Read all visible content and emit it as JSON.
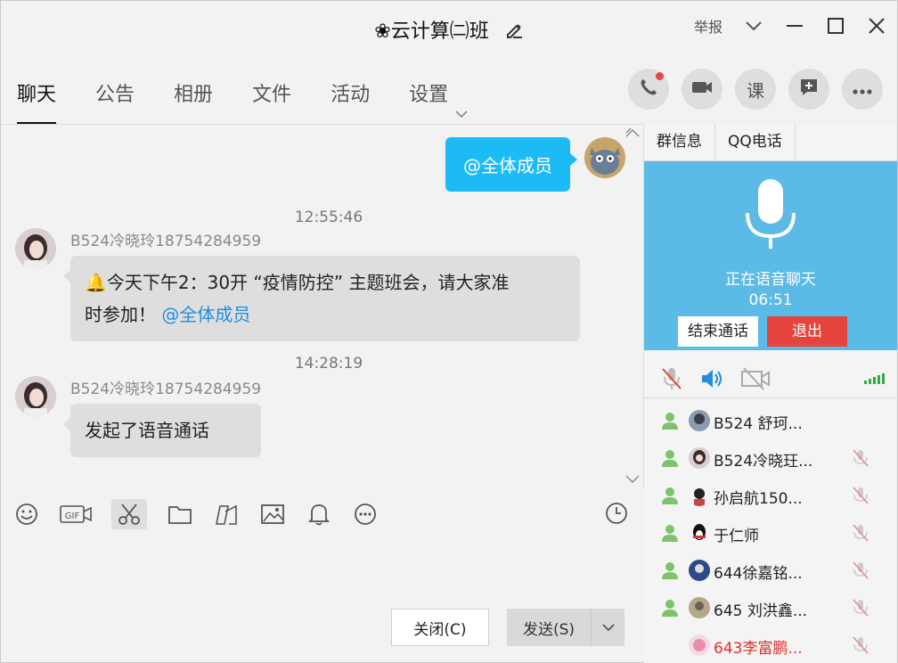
{
  "window": {
    "title": "❀云计算㈡班",
    "report_label": "举报"
  },
  "tabs": [
    {
      "label": "聊天",
      "active": true
    },
    {
      "label": "公告"
    },
    {
      "label": "相册"
    },
    {
      "label": "文件"
    },
    {
      "label": "活动"
    },
    {
      "label": "设置"
    }
  ],
  "round_actions": [
    "phone-icon",
    "video-icon",
    "lesson-icon",
    "add-message-icon",
    "more-icon"
  ],
  "round_labels": {
    "lesson": "课"
  },
  "chat": {
    "self_message": "@全体成员",
    "messages": [
      {
        "time": "12:55:46",
        "sender": "B524冷晓玲18754284959",
        "text_part1": "今天下午2：30开 “疫情防控” 主题班会，请大家准",
        "text_part2": "时参加！",
        "mention": "@全体成员"
      },
      {
        "time": "14:28:19",
        "sender": "B524冷晓玲18754284959",
        "text": "发起了语音通话"
      }
    ]
  },
  "toolbar": [
    "emoji-icon",
    "gif-icon",
    "scissors-icon",
    "folder-icon",
    "shape-icon",
    "image-icon",
    "bell-icon",
    "more-circle-icon",
    "clock-icon"
  ],
  "toolbar_gif_label": "GIF",
  "buttons": {
    "close": "关闭(C)",
    "send": "发送(S)"
  },
  "right_panel": {
    "tabs": [
      "群信息",
      "QQ电话"
    ],
    "voice": {
      "status": "正在语音聊天",
      "duration": "06:51",
      "end_call": "结束通话",
      "exit": "退出"
    },
    "members": [
      {
        "name": "B524 舒珂...",
        "muted": false,
        "red": false
      },
      {
        "name": "B524冷晓玨...",
        "muted": true,
        "red": false
      },
      {
        "name": "孙启航150...",
        "muted": true,
        "red": false
      },
      {
        "name": "于仁师",
        "muted": true,
        "red": false
      },
      {
        "name": "644徐嘉铭...",
        "muted": true,
        "red": false
      },
      {
        "name": "645 刘洪鑫...",
        "muted": true,
        "red": false
      },
      {
        "name": "643李富鹏...",
        "muted": true,
        "red": true
      }
    ]
  },
  "colors": {
    "accent_blue": "#1dbbf5",
    "voice_card": "#5bbae6",
    "exit_red": "#e5453d",
    "mention": "#1f8ee0"
  }
}
